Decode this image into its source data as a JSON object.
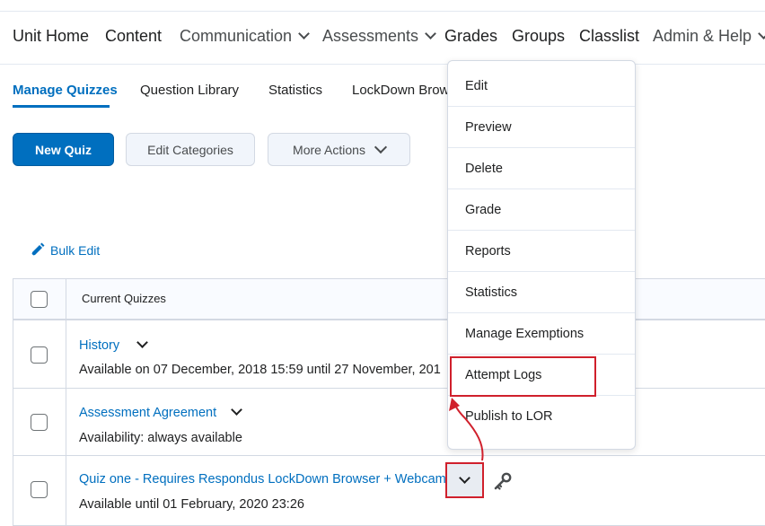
{
  "topnav": {
    "items": [
      {
        "label": "Unit Home",
        "dropdown": false
      },
      {
        "label": "Content",
        "dropdown": false
      },
      {
        "label": "Communication",
        "dropdown": true
      },
      {
        "label": "Assessments",
        "dropdown": true
      },
      {
        "label": "Grades",
        "dropdown": false
      },
      {
        "label": "Groups",
        "dropdown": false
      },
      {
        "label": "Classlist",
        "dropdown": false
      },
      {
        "label": "Admin & Help",
        "dropdown": true
      }
    ]
  },
  "tabs": [
    {
      "label": "Manage Quizzes",
      "active": true
    },
    {
      "label": "Question Library",
      "active": false
    },
    {
      "label": "Statistics",
      "active": false
    },
    {
      "label": "LockDown Brow",
      "active": false
    }
  ],
  "toolbar": {
    "new_quiz": "New Quiz",
    "edit_categories": "Edit Categories",
    "more_actions": "More Actions"
  },
  "bulk_edit": {
    "label": "Bulk Edit",
    "icon": "pencil-icon"
  },
  "table": {
    "header": "Current Quizzes",
    "rows": [
      {
        "title": "History",
        "availability": "Available on 07 December, 2018 15:59 until 27 November, 201"
      },
      {
        "title": "Assessment Agreement",
        "availability": "Availability: always available"
      },
      {
        "title": "Quiz one - Requires Respondus LockDown Browser + Webcam",
        "availability": "Available until 01 February, 2020 23:26"
      }
    ]
  },
  "context_menu": {
    "items": [
      "Edit",
      "Preview",
      "Delete",
      "Grade",
      "Reports",
      "Statistics",
      "Manage Exemptions",
      "Attempt Logs",
      "Publish to LOR"
    ],
    "highlighted": "Attempt Logs"
  },
  "colors": {
    "accent": "#006fbf",
    "highlight": "#d0202c"
  }
}
